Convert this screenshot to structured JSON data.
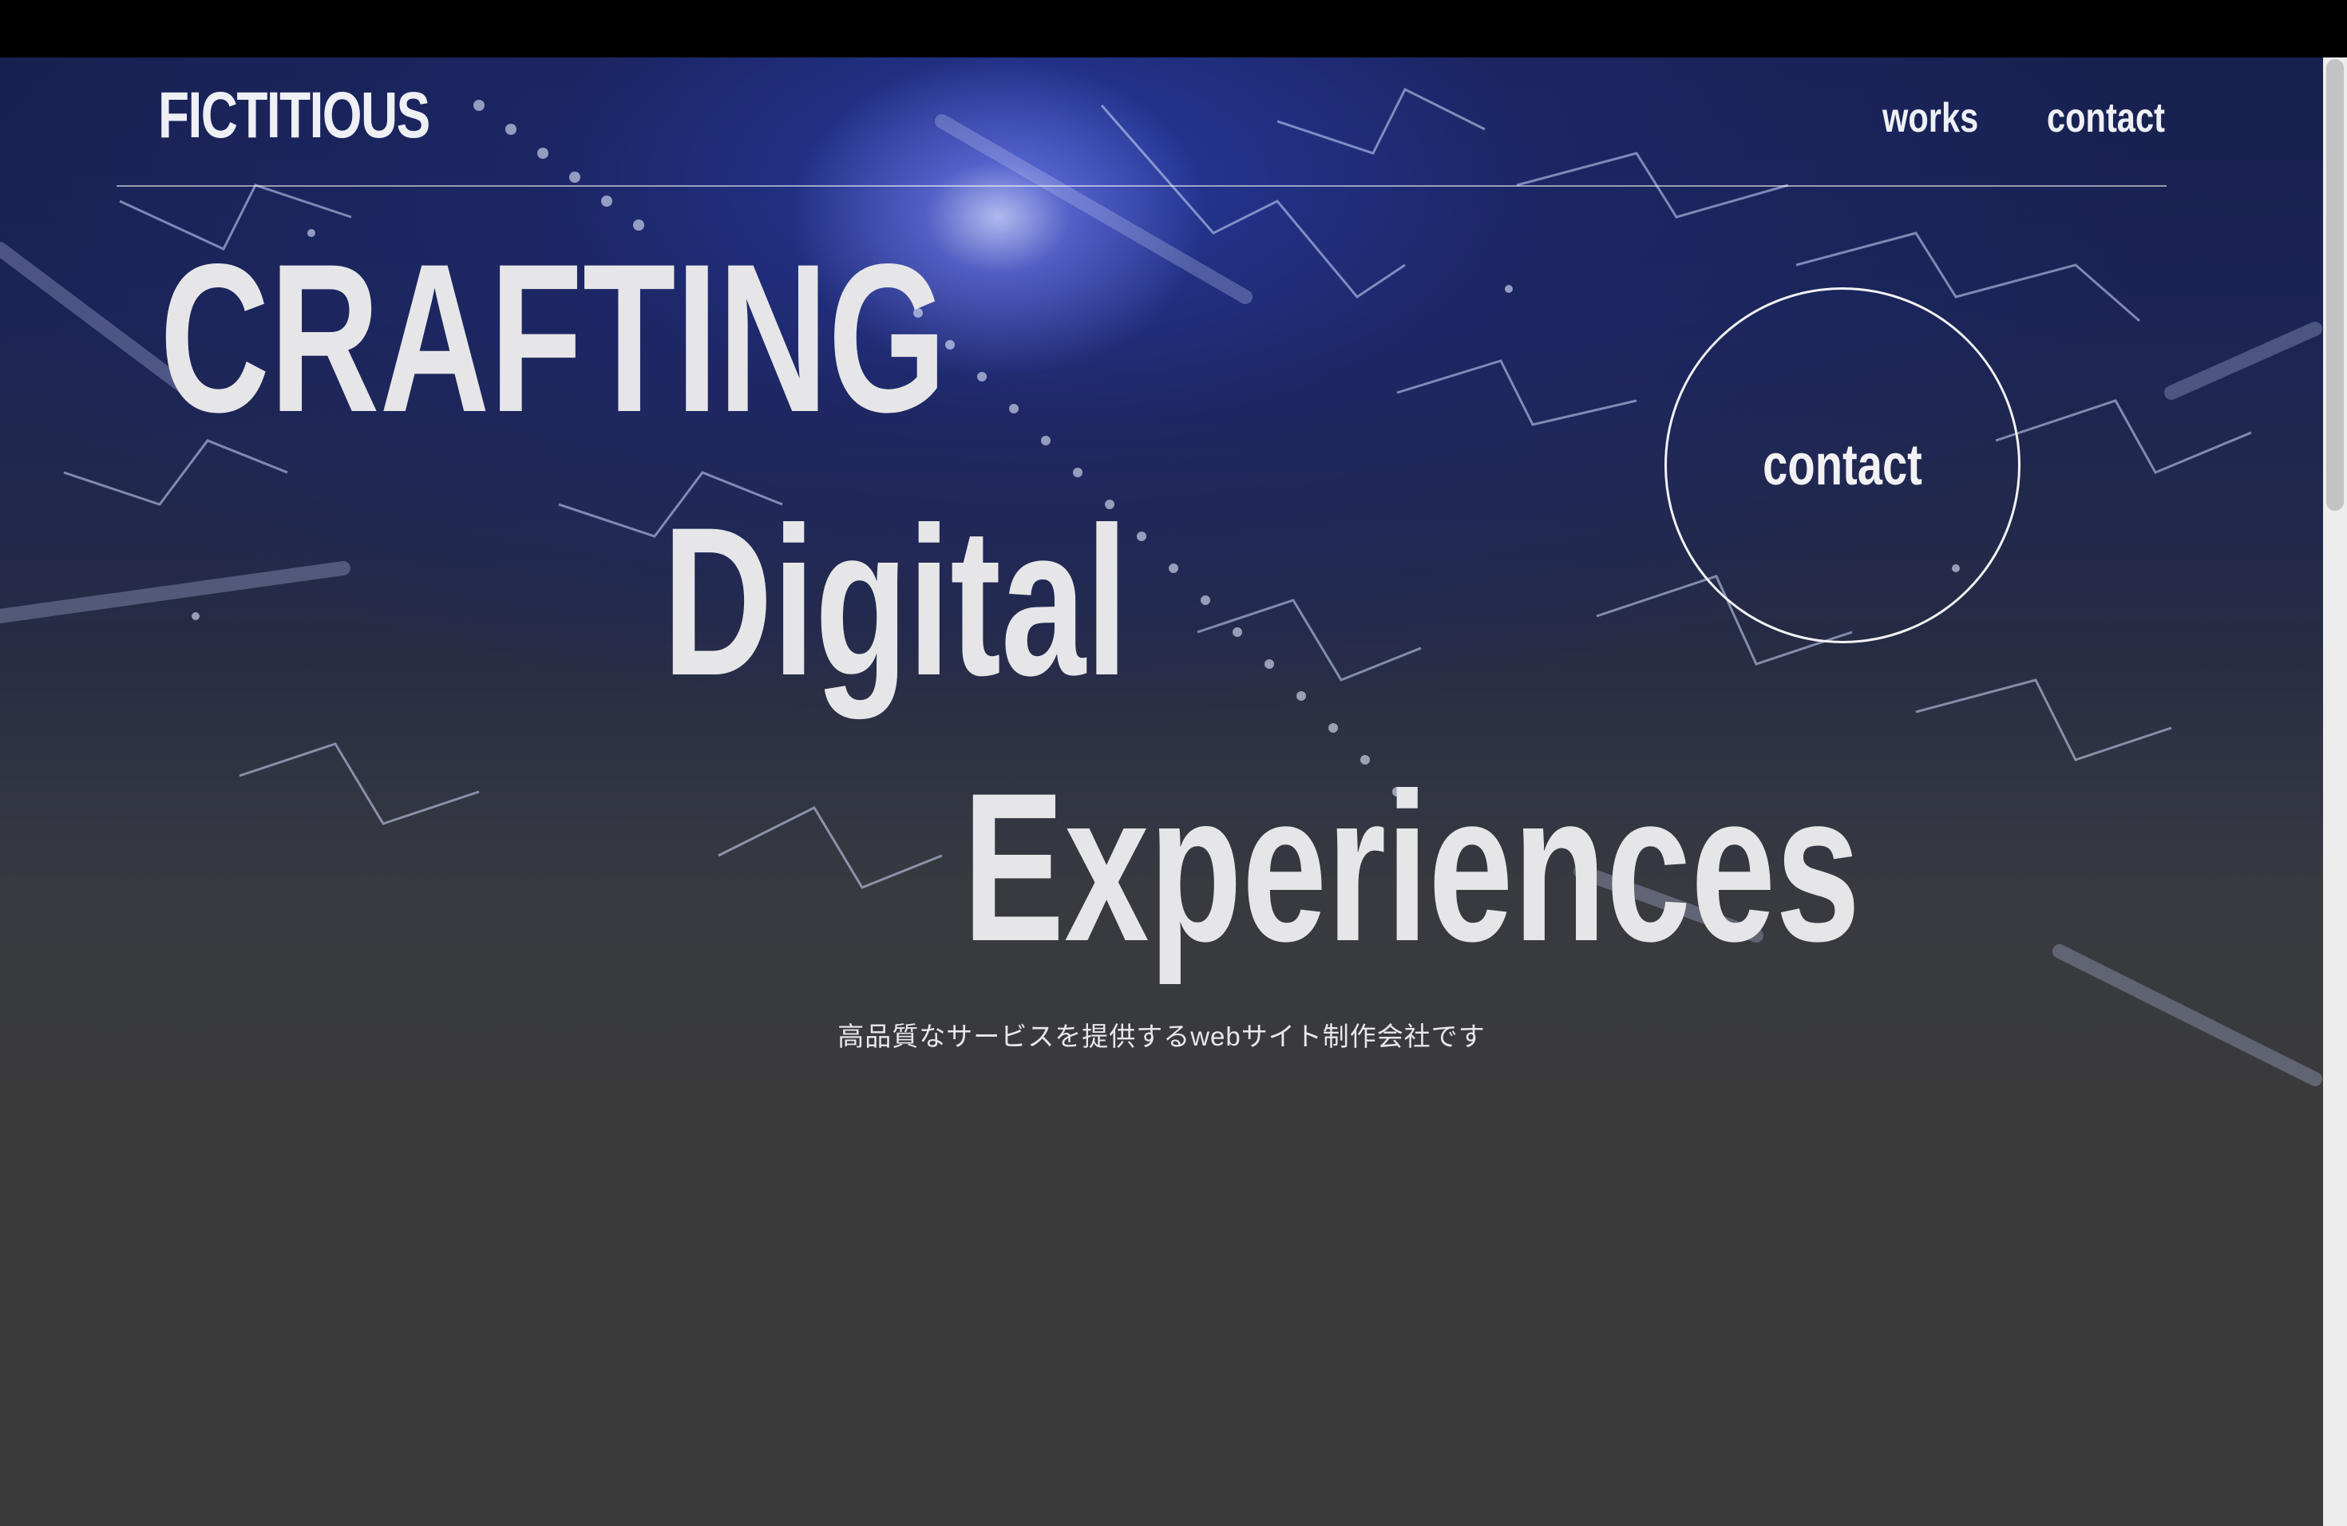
{
  "header": {
    "logo": "FICTITIOUS",
    "nav": [
      {
        "label": "works"
      },
      {
        "label": "contact"
      }
    ]
  },
  "hero": {
    "lines": [
      "CRAFTING",
      "Digital",
      "Experiences"
    ],
    "contact_button": "contact",
    "tagline": "高品質なサービスを提供するwebサイト制作会社です"
  },
  "colors": {
    "background": "#3a3a3b",
    "hero_blue": "#1b2455",
    "text": "#e6e6e8"
  }
}
